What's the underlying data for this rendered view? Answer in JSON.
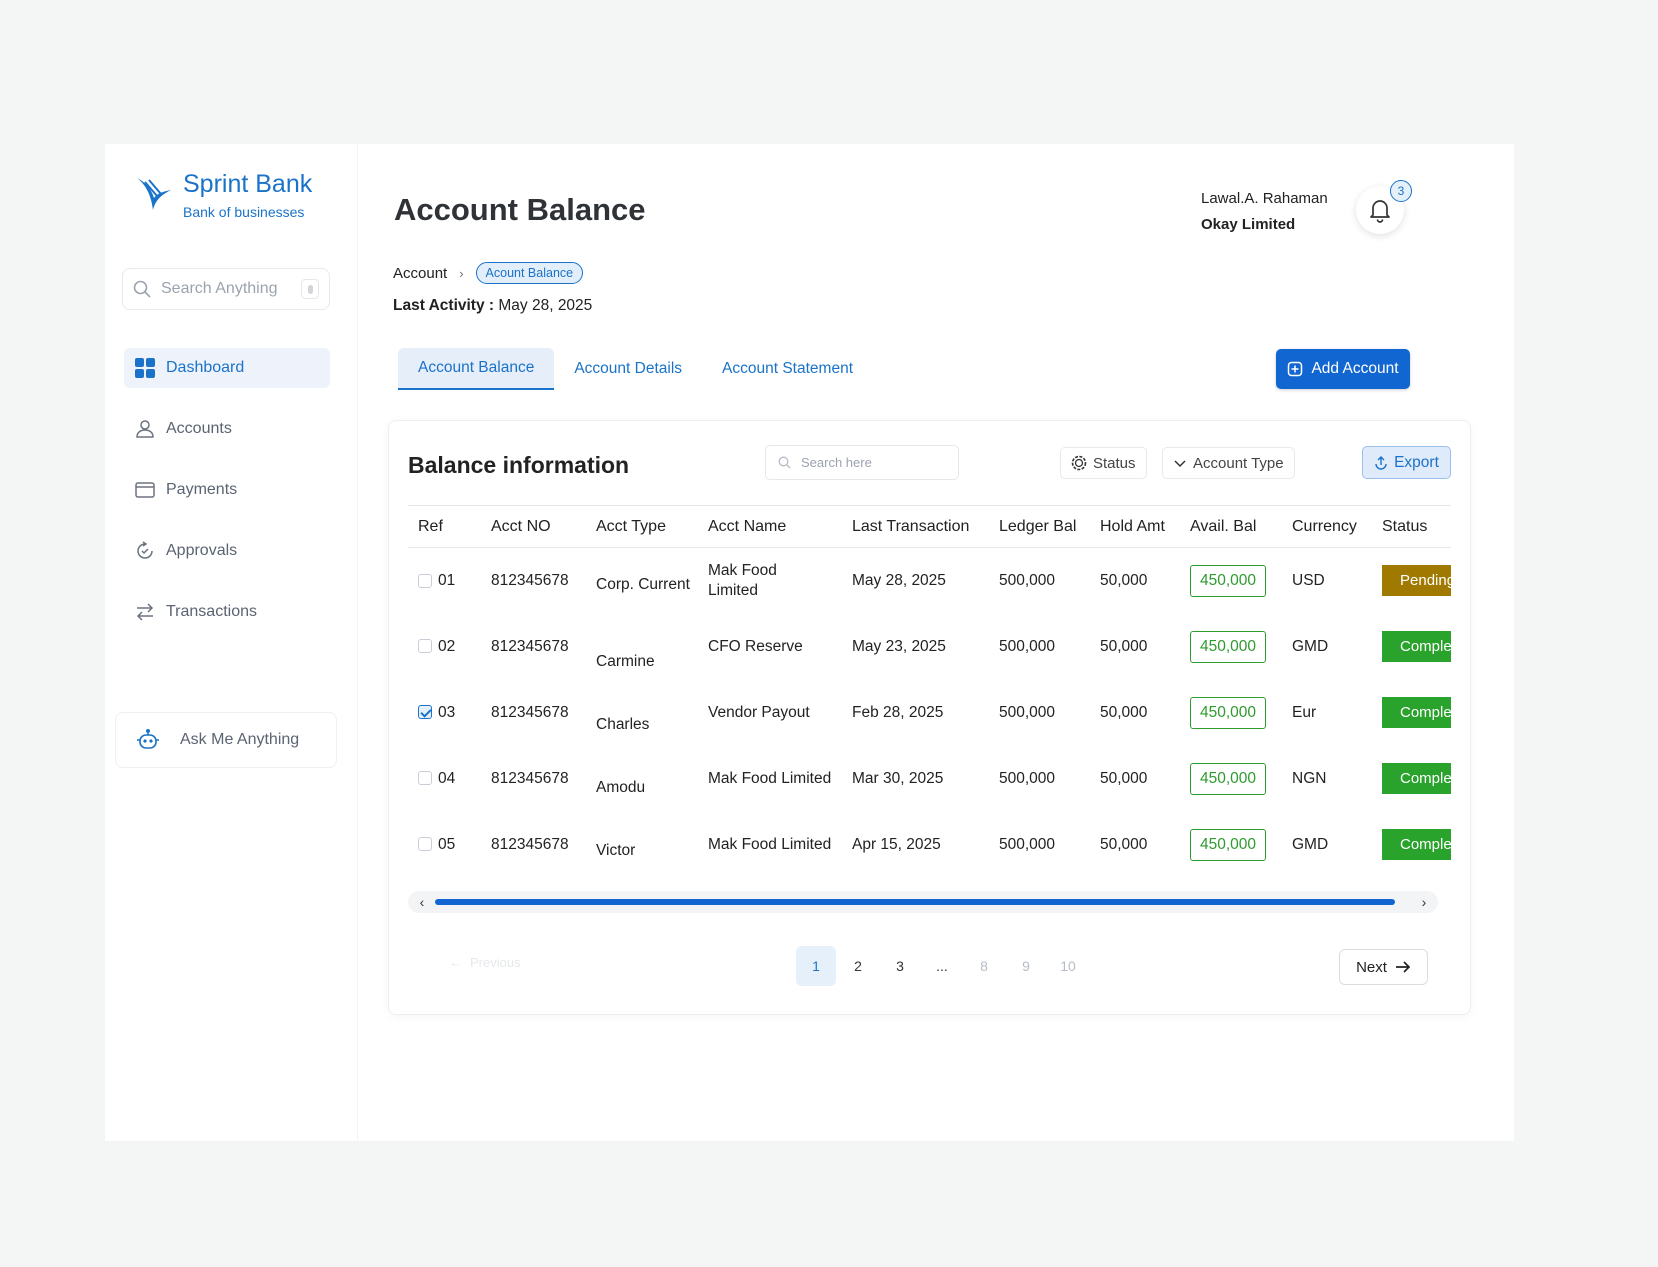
{
  "brand": {
    "name": "Sprint Bank",
    "tagline": "Bank of businesses"
  },
  "sidebar": {
    "search_placeholder": "Search Anything",
    "items": [
      {
        "label": "Dashboard",
        "icon": "grid-icon",
        "active": true
      },
      {
        "label": "Accounts",
        "icon": "user-icon"
      },
      {
        "label": "Payments",
        "icon": "card-icon"
      },
      {
        "label": "Approvals",
        "icon": "refresh-icon"
      },
      {
        "label": "Transactions",
        "icon": "swap-icon"
      }
    ],
    "ask_label": "Ask Me Anything"
  },
  "header": {
    "title": "Account Balance",
    "user_name": "Lawal.A. Rahaman",
    "company": "Okay Limited",
    "notifications": "3"
  },
  "breadcrumb": {
    "root": "Account",
    "current": "Acount Balance"
  },
  "last_activity": {
    "label": "Last Activity :",
    "value": "May 28, 2025"
  },
  "tabs": [
    {
      "label": "Account Balance",
      "active": true
    },
    {
      "label": "Account Details"
    },
    {
      "label": "Account Statement"
    }
  ],
  "add_account_label": "Add Account",
  "card": {
    "title": "Balance information",
    "search_placeholder": "Search here",
    "status_filter": "Status",
    "type_filter": "Account Type",
    "export_label": "Export"
  },
  "table": {
    "headers": [
      "Ref",
      "Acct NO",
      "Acct Type",
      "Acct Name",
      "Last Transaction",
      "Ledger Bal",
      "Hold Amt",
      "Avail. Bal",
      "Currency",
      "Status"
    ],
    "rows": [
      {
        "ref": "01",
        "checked": false,
        "acct_no": "812345678",
        "acct_type": "Corp. Current",
        "acct_name": "Mak Food Limited",
        "last_txn": "May 28, 2025",
        "ledger": "500,000",
        "hold": "50,000",
        "avail": "450,000",
        "currency": "USD",
        "status": "Pending"
      },
      {
        "ref": "02",
        "checked": false,
        "acct_no": "812345678",
        "acct_type": "Carmine",
        "acct_name": "CFO Reserve",
        "last_txn": "May 23, 2025",
        "ledger": "500,000",
        "hold": "50,000",
        "avail": "450,000",
        "currency": "GMD",
        "status": "Complete"
      },
      {
        "ref": "03",
        "checked": true,
        "acct_no": "812345678",
        "acct_type": "Charles",
        "acct_name": "Vendor Payout",
        "last_txn": "Feb 28, 2025",
        "ledger": "500,000",
        "hold": "50,000",
        "avail": "450,000",
        "currency": "Eur",
        "status": "Complete"
      },
      {
        "ref": "04",
        "checked": false,
        "acct_no": "812345678",
        "acct_type": "Amodu",
        "acct_name": "Mak Food Limited",
        "last_txn": "Mar 30, 2025",
        "ledger": "500,000",
        "hold": "50,000",
        "avail": "450,000",
        "currency": "NGN",
        "status": "Complete"
      },
      {
        "ref": "05",
        "checked": false,
        "acct_no": "812345678",
        "acct_type": "Victor",
        "acct_name": "Mak Food Limited",
        "last_txn": "Apr 15, 2025",
        "ledger": "500,000",
        "hold": "50,000",
        "avail": "450,000",
        "currency": "GMD",
        "status": "Complete"
      }
    ]
  },
  "pagination": {
    "previous": "Previous",
    "next": "Next",
    "pages": [
      "1",
      "2",
      "3",
      "...",
      "8",
      "9",
      "10"
    ],
    "current": "1"
  },
  "colors": {
    "accent": "#1266d1",
    "pending": "#a07a00",
    "complete": "#29a32c"
  }
}
